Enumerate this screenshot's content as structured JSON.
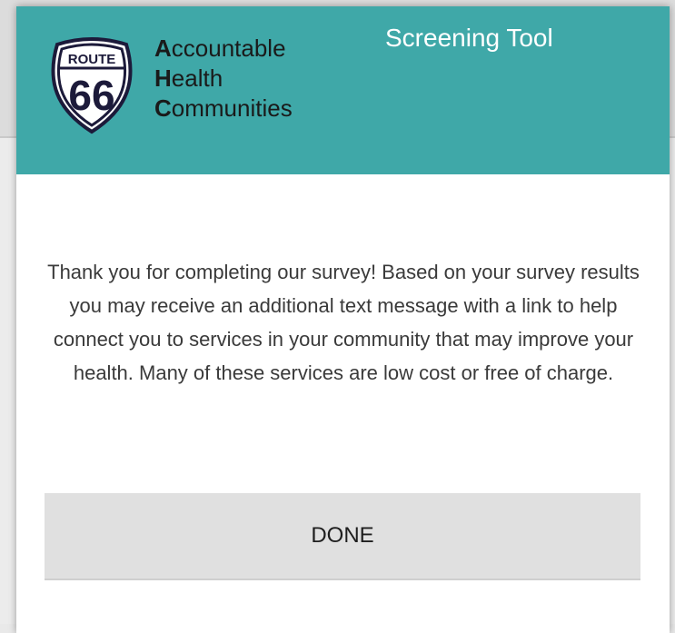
{
  "header": {
    "title": "Screening Tool",
    "background_color": "#3fa8a8",
    "title_color": "#ffffff"
  },
  "logo": {
    "shield_text": "ROUTE",
    "shield_number": "66",
    "brand_lines": [
      {
        "initial": "A",
        "rest": "ccountable"
      },
      {
        "initial": "H",
        "rest": "ealth"
      },
      {
        "initial": "C",
        "rest": "ommunities"
      }
    ]
  },
  "message": {
    "text": "Thank you for completing our survey! Based on your survey results you may receive an additional text message with a link to help connect you to services in your community that may improve your health. Many of these services are low cost or free of charge."
  },
  "actions": {
    "done_label": "DONE",
    "button_color": "#e0e0e0"
  }
}
